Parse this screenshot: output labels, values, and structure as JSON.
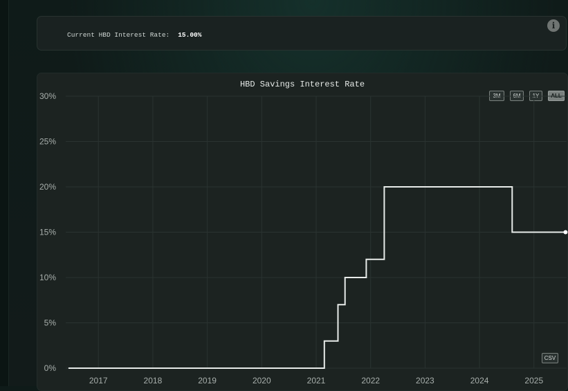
{
  "header": {
    "rate_label": "Current HBD Interest Rate:",
    "rate_value": "15.00%"
  },
  "icons": {
    "info": "info-icon"
  },
  "controls": {
    "ranges": [
      "3M",
      "6M",
      "1Y",
      "ALL"
    ],
    "active_range": "ALL",
    "csv_label": "CSV"
  },
  "colors": {
    "line": "#e8ecea",
    "grid": "#2a3331",
    "card": "#1c2321",
    "background": "#111b19"
  },
  "chart_data": {
    "type": "line",
    "title": "HBD Savings Interest Rate",
    "xlabel": "",
    "ylabel": "",
    "x_ticks": [
      "2017",
      "2018",
      "2019",
      "2020",
      "2021",
      "2022",
      "2023",
      "2024",
      "2025"
    ],
    "y_ticks": [
      "0%",
      "5%",
      "10%",
      "15%",
      "20%",
      "25%",
      "30%"
    ],
    "ylim": [
      0,
      30
    ],
    "xlim": [
      2016.4,
      2025.6
    ],
    "step": true,
    "grid": true,
    "series": [
      {
        "x": [
          2016.45,
          2021.15,
          2021.15,
          2021.4,
          2021.4,
          2021.53,
          2021.53,
          2021.92,
          2021.92,
          2022.25,
          2022.25,
          2024.6,
          2024.6,
          2025.58
        ],
        "y": [
          0,
          0,
          3,
          3,
          7,
          7,
          10,
          10,
          12,
          12,
          20,
          20,
          15,
          15
        ]
      }
    ]
  }
}
